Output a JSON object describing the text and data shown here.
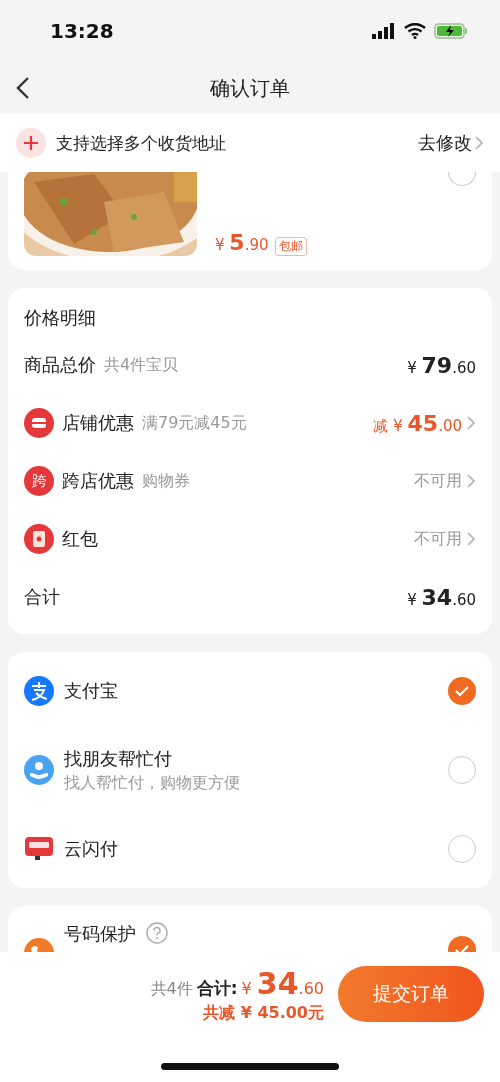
{
  "status_bar": {
    "time": "13:28"
  },
  "nav": {
    "title": "确认订单"
  },
  "address_banner": {
    "text": "支持选择多个收货地址",
    "action": "去修改"
  },
  "product": {
    "currency": "¥",
    "price_int": "5",
    "price_dec": ".90",
    "tag": "包邮",
    "selected": false
  },
  "price_details": {
    "title": "价格明细",
    "rows": [
      {
        "kind": "plain",
        "label": "商品总价",
        "note": "共4件宝贝",
        "currency": "¥",
        "int": "79",
        "dec": ".60"
      },
      {
        "kind": "store",
        "label": "店铺优惠",
        "note": "满79元减45元",
        "prefix": "减",
        "currency": "¥",
        "int": "45",
        "dec": ".00"
      },
      {
        "kind": "cross",
        "badge": "跨",
        "label": "跨店优惠",
        "note": "购物券",
        "text": "不可用"
      },
      {
        "kind": "redpacket",
        "label": "红包",
        "text": "不可用"
      },
      {
        "kind": "plain",
        "label": "合计",
        "currency": "¥",
        "int": "34",
        "dec": ".60"
      }
    ]
  },
  "payment_methods": [
    {
      "kind": "alipay",
      "label": "支付宝",
      "selected": true
    },
    {
      "kind": "friend",
      "label": "找朋友帮忙付",
      "subtitle": "找人帮忙付，购物更方便",
      "selected": false
    },
    {
      "kind": "unionpay",
      "label": "云闪付",
      "selected": false
    }
  ],
  "phone_protection": {
    "label": "号码保护",
    "checked": true
  },
  "bottom_bar": {
    "count": "共4件",
    "total_label": "合计:",
    "currency": "¥",
    "int": "34",
    "dec": ".60",
    "saving": "共减 ¥ 45.00元",
    "submit": "提交订单"
  }
}
